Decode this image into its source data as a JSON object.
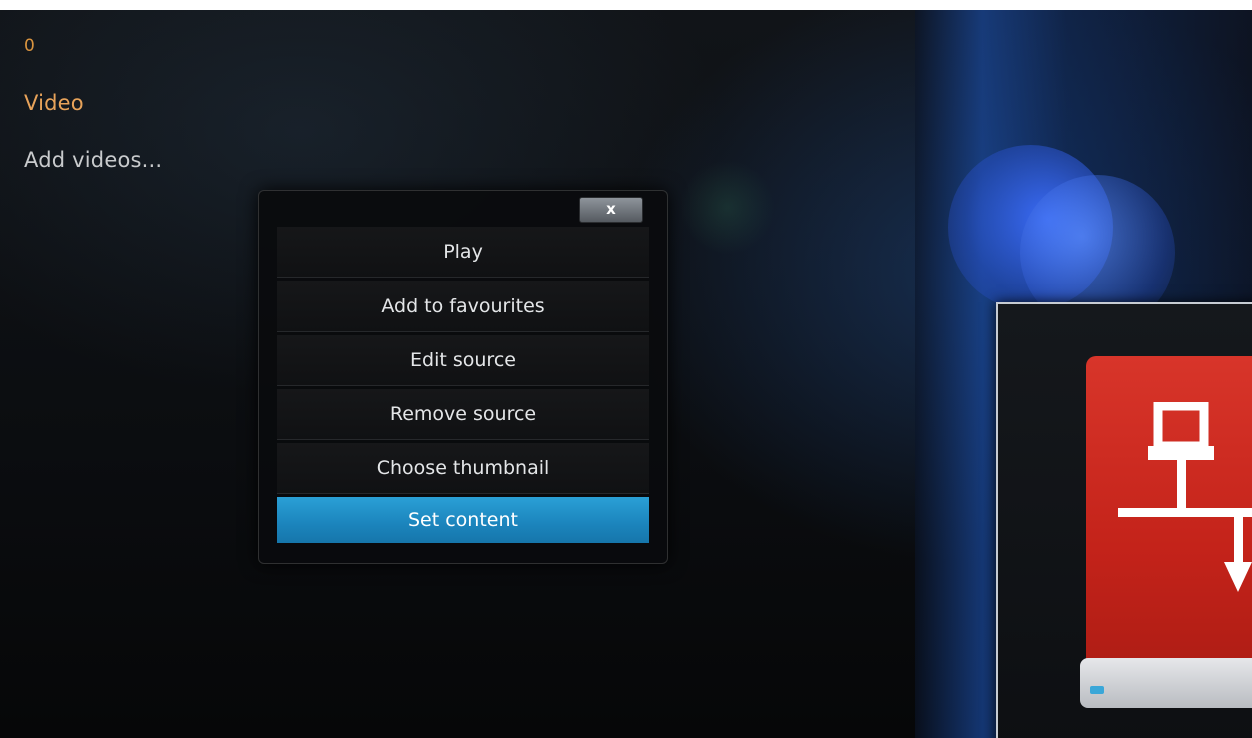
{
  "sidebar": {
    "count": "0",
    "section_title": "Video",
    "add_item": "Add videos..."
  },
  "context_menu": {
    "close_label": "x",
    "items": [
      {
        "label": "Play"
      },
      {
        "label": "Add to favourites"
      },
      {
        "label": "Edit source"
      },
      {
        "label": "Remove source"
      },
      {
        "label": "Choose thumbnail"
      },
      {
        "label": "Set content",
        "selected": true
      }
    ]
  },
  "artwork": {
    "icon": "network-drive-icon",
    "drive_color": "#d8352a",
    "highlight_color": "#1b84bc",
    "accent_orange": "#e8a35a"
  }
}
